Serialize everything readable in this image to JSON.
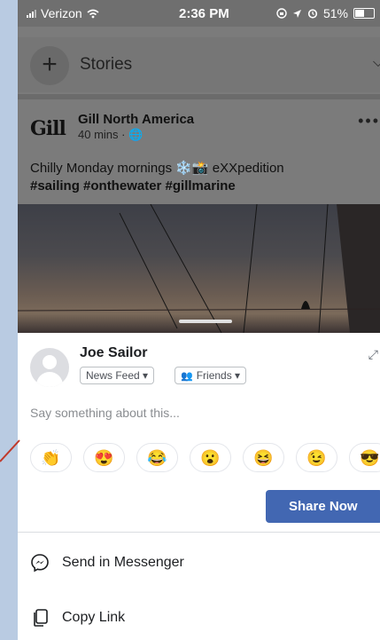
{
  "status_bar": {
    "carrier": "Verizon",
    "time": "2:36 PM",
    "battery": "51%",
    "icons": [
      "signal-icon",
      "wifi-icon",
      "lock-rotation-icon",
      "location-icon",
      "alarm-icon",
      "battery-icon"
    ]
  },
  "stories": {
    "label": "Stories",
    "add_icon": "+",
    "chevron_icon": "chevron-down-icon"
  },
  "post": {
    "logo_text": "Gill",
    "page_name": "Gill North America",
    "meta": "40 mins · 🌐",
    "text_line1": "Chilly Monday mornings ❄️📸 eXXpedition",
    "text_line2": "#sailing #onthewater #gillmarine",
    "more_icon": "•••"
  },
  "share_sheet": {
    "user_name": "Joe Sailor",
    "audience_feed": "News Feed ▾",
    "audience_privacy": "Friends ▾",
    "placeholder": "Say something about this...",
    "emojis": [
      "👏",
      "😍",
      "😂",
      "😮",
      "😆",
      "😉",
      "😎"
    ],
    "share_button": "Share Now",
    "menu": [
      {
        "label": "Send in Messenger",
        "icon": "messenger-icon"
      },
      {
        "label": "Copy Link",
        "icon": "copy-link-icon"
      }
    ]
  },
  "colors": {
    "page_bg": "#b9cbe2",
    "share_button_bg": "#4267b2",
    "annotation_line": "#c0392b"
  }
}
